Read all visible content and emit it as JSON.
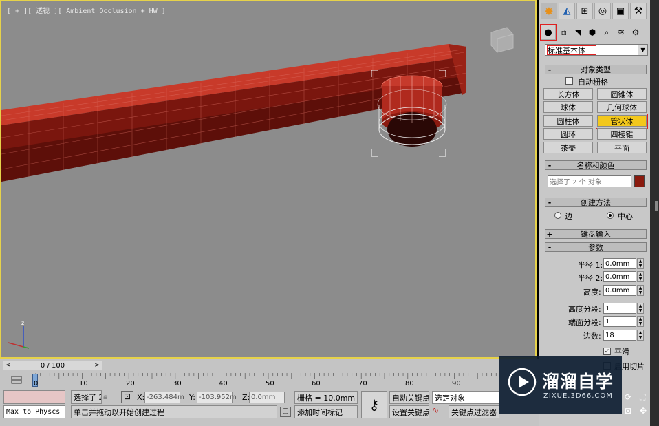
{
  "viewport": {
    "label": "[ + ][ 透视 ][ Ambient Occlusion + HW ]",
    "axis_labels": {
      "x": "x",
      "y": "y",
      "z": "z"
    },
    "pipe_color": "#b32418",
    "background": "#8c8c8c"
  },
  "command_panel": {
    "top_tabs": [
      "create-icon",
      "modify-icon",
      "hierarchy-icon",
      "motion-icon",
      "display-icon",
      "utilities-icon"
    ],
    "sub_tabs": [
      "geometry-icon",
      "shapes-icon",
      "lights-icon",
      "cameras-icon",
      "helpers-icon",
      "spacewarps-icon",
      "systems-icon"
    ],
    "category": "标准基本体",
    "object_type": {
      "title": "对象类型",
      "autogrid_label": "自动栅格",
      "buttons": [
        "长方体",
        "圆锥体",
        "球体",
        "几何球体",
        "圆柱体",
        "管状体",
        "圆环",
        "四棱锥",
        "茶壶",
        "平面"
      ],
      "active": "管状体"
    },
    "name_color": {
      "title": "名称和颜色",
      "name_value": "选择了 2 个 对象",
      "swatch_color": "#8a1a0e"
    },
    "creation_method": {
      "title": "创建方法",
      "options": [
        "边",
        "中心"
      ],
      "selected": "中心"
    },
    "keyboard_entry": {
      "title": "键盘输入"
    },
    "parameters": {
      "title": "参数",
      "radius1_label": "半径 1:",
      "radius1_value": "0.0mm",
      "radius2_label": "半径 2:",
      "radius2_value": "0.0mm",
      "height_label": "高度:",
      "height_value": "0.0mm",
      "height_segs_label": "高度分段:",
      "height_segs_value": "1",
      "cap_segs_label": "端面分段:",
      "cap_segs_value": "1",
      "sides_label": "边数:",
      "sides_value": "18",
      "smooth_label": "平滑",
      "slice_label": "启用切片"
    }
  },
  "timeline": {
    "frame_display": "0 / 100",
    "prev": "<",
    "next": ">",
    "ticks": [
      "0",
      "10",
      "20",
      "30",
      "40",
      "50",
      "60",
      "70",
      "80",
      "90"
    ]
  },
  "status_bar": {
    "maxscript": "Max to Physcs (",
    "selected": "选择了 2",
    "x_label": "X:",
    "x_value": "-263.484m",
    "y_label": "Y:",
    "y_value": "-103.952m",
    "z_label": "Z:",
    "z_value": "0.0mm",
    "grid": "栅格 = 10.0mm",
    "prompt": "单击并拖动以开始创建过程",
    "add_time_tag": "添加时间标记",
    "auto_key": "自动关键点",
    "set_key": "设置关键点",
    "selection_set": "选定对象",
    "key_filters": "关键点过滤器"
  },
  "watermark": {
    "title": "溜溜自学",
    "url": "ZIXUE.3D66.COM"
  }
}
